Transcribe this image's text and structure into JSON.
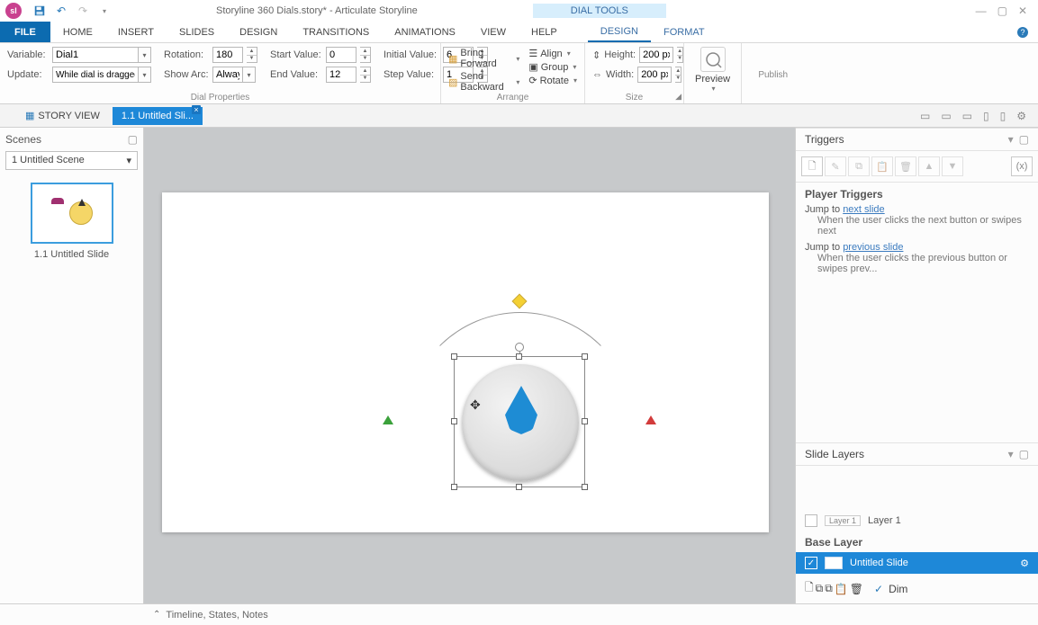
{
  "title": "Storyline 360 Dials.story* - Articulate Storyline",
  "contextTab": "DIAL TOOLS",
  "ribbonTabs": {
    "file": "FILE",
    "home": "HOME",
    "insert": "INSERT",
    "slides": "SLIDES",
    "design": "DESIGN",
    "transitions": "TRANSITIONS",
    "animations": "ANIMATIONS",
    "view": "VIEW",
    "help": "HELP",
    "ctxDesign": "DESIGN",
    "ctxFormat": "FORMAT"
  },
  "dialProps": {
    "variableLabel": "Variable:",
    "variableValue": "Dial1",
    "updateLabel": "Update:",
    "updateValue": "While dial is dragged",
    "rotationLabel": "Rotation:",
    "rotationValue": "180",
    "showArcLabel": "Show Arc:",
    "showArcValue": "Always",
    "startLabel": "Start Value:",
    "startValue": "0",
    "endLabel": "End Value:",
    "endValue": "12",
    "initialLabel": "Initial Value:",
    "initialValue": "6",
    "stepLabel": "Step Value:",
    "stepValue": "1",
    "groupLabel": "Dial Properties"
  },
  "arrange": {
    "bringForward": "Bring Forward",
    "sendBackward": "Send Backward",
    "align": "Align",
    "group": "Group",
    "rotate": "Rotate",
    "label": "Arrange"
  },
  "size": {
    "heightLabel": "Height:",
    "heightValue": "200 px",
    "widthLabel": "Width:",
    "widthValue": "200 px",
    "label": "Size"
  },
  "preview": "Preview",
  "publish": "Publish",
  "viewTabs": {
    "story": "STORY VIEW",
    "slide": "1.1 Untitled Sli..."
  },
  "scenes": {
    "header": "Scenes",
    "dropdown": "1 Untitled Scene",
    "thumbCaption": "1.1 Untitled Slide"
  },
  "triggers": {
    "header": "Triggers",
    "section": "Player Triggers",
    "t1a": "Jump to ",
    "t1b": "next slide",
    "t1desc": "When the user clicks the next button or swipes next",
    "t2a": "Jump to ",
    "t2b": "previous slide",
    "t2desc": "When the user clicks the previous button or swipes prev..."
  },
  "layers": {
    "header": "Slide Layers",
    "layer1chip": "Layer 1",
    "layer1": "Layer 1",
    "baseHeader": "Base Layer",
    "baseName": "Untitled Slide",
    "dim": "Dim"
  },
  "status": "Timeline, States, Notes"
}
